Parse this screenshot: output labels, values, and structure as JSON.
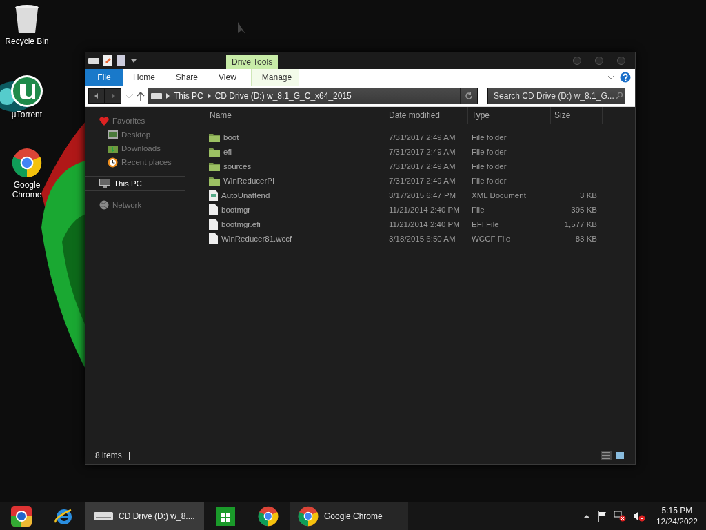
{
  "desktop_icons": [
    {
      "kind": "recycle",
      "label": "Recycle Bin"
    },
    {
      "kind": "torrent",
      "label": "µTorrent"
    },
    {
      "kind": "chrome",
      "label": "Google Chrome"
    }
  ],
  "window": {
    "contextual_tab": "Drive Tools",
    "ribbon_tabs": [
      {
        "label": "File",
        "kind": "file"
      },
      {
        "label": "Home",
        "kind": "plain"
      },
      {
        "label": "Share",
        "kind": "plain"
      },
      {
        "label": "View",
        "kind": "plain"
      },
      {
        "label": "Manage",
        "kind": "contextual"
      }
    ],
    "address": {
      "segments": [
        "This PC",
        "CD Drive (D:) w_8.1_G_C_x64_2015"
      ]
    },
    "search": {
      "placeholder": "Search CD Drive (D:) w_8.1_G..."
    },
    "navigation": [
      {
        "label": "Favorites",
        "kind": "favorites",
        "selected": false,
        "children": [
          {
            "label": "Desktop",
            "kind": "desktop",
            "selected": false
          },
          {
            "label": "Downloads",
            "kind": "downloads",
            "selected": false
          },
          {
            "label": "Recent places",
            "kind": "recent",
            "selected": false
          }
        ]
      },
      {
        "label": "This PC",
        "kind": "pc",
        "selected": true
      },
      {
        "label": "Network",
        "kind": "network",
        "selected": false
      }
    ],
    "columns": [
      "Name",
      "Date modified",
      "Type",
      "Size"
    ],
    "rows": [
      {
        "kind": "folder",
        "name": "boot",
        "date": "7/31/2017 2:49 AM",
        "type": "File folder",
        "size": ""
      },
      {
        "kind": "folder",
        "name": "efi",
        "date": "7/31/2017 2:49 AM",
        "type": "File folder",
        "size": ""
      },
      {
        "kind": "folder",
        "name": "sources",
        "date": "7/31/2017 2:49 AM",
        "type": "File folder",
        "size": ""
      },
      {
        "kind": "folder",
        "name": "WinReducerPI",
        "date": "7/31/2017 2:49 AM",
        "type": "File folder",
        "size": ""
      },
      {
        "kind": "xml",
        "name": "AutoUnattend",
        "date": "3/17/2015 6:47 PM",
        "type": "XML Document",
        "size": "3 KB"
      },
      {
        "kind": "file",
        "name": "bootmgr",
        "date": "11/21/2014 2:40 PM",
        "type": "File",
        "size": "395 KB"
      },
      {
        "kind": "file",
        "name": "bootmgr.efi",
        "date": "11/21/2014 2:40 PM",
        "type": "EFI File",
        "size": "1,577 KB"
      },
      {
        "kind": "file",
        "name": "WinReducer81.wccf",
        "date": "3/18/2015 6:50 AM",
        "type": "WCCF File",
        "size": "83 KB"
      }
    ],
    "status": "8 items"
  },
  "taskbar": {
    "items": [
      {
        "kind": "start"
      },
      {
        "kind": "ie"
      },
      {
        "kind": "drive",
        "label": "CD Drive (D:) w_8...."
      },
      {
        "kind": "store"
      },
      {
        "kind": "chrome"
      },
      {
        "kind": "chrome",
        "label": "Google Chrome"
      }
    ],
    "time": "5:15 PM",
    "date": "12/24/2022"
  }
}
